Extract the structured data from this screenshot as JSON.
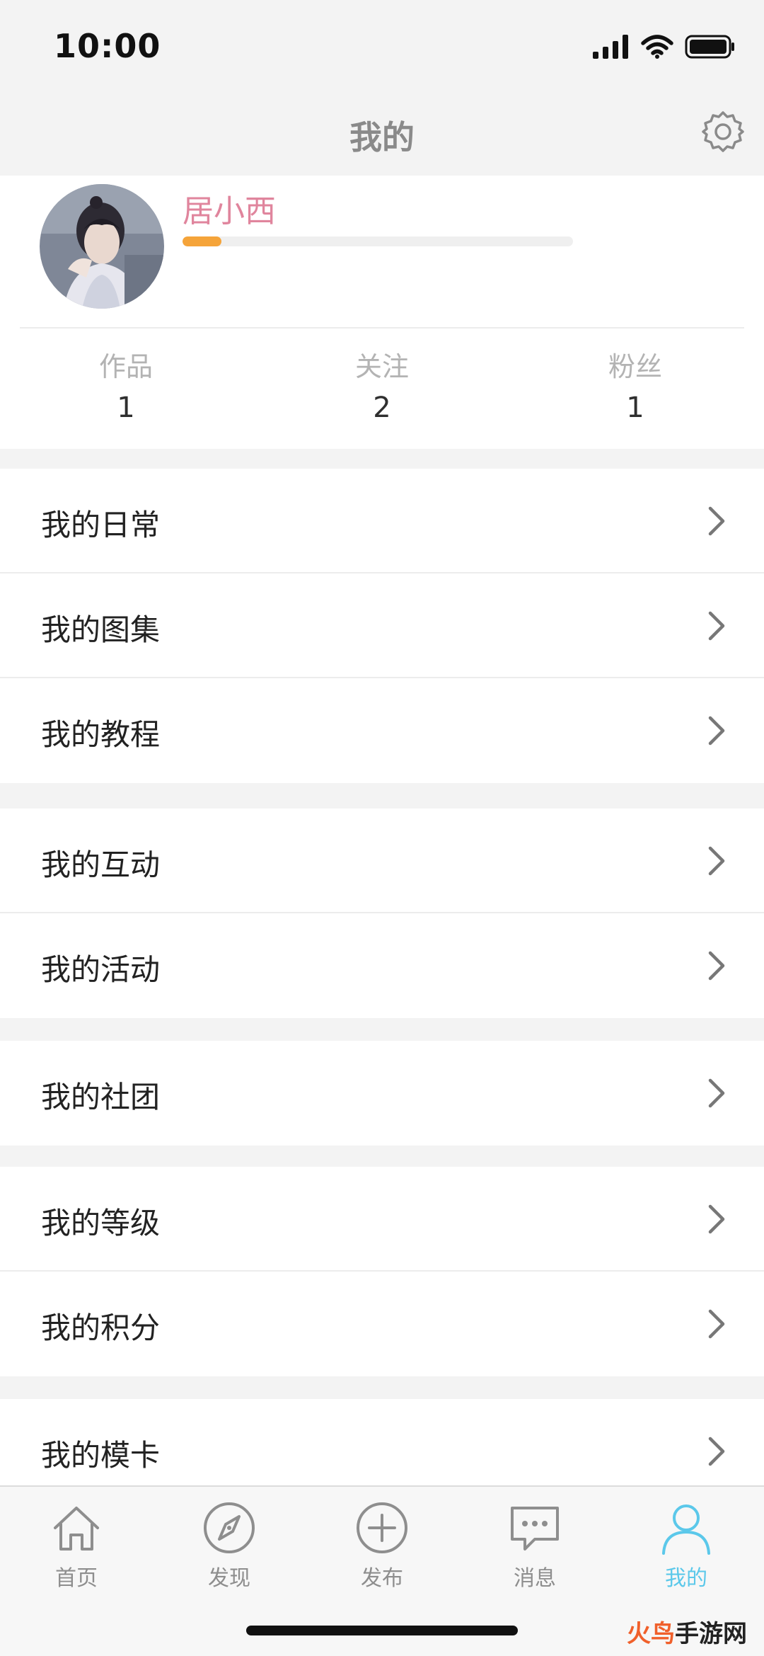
{
  "status_bar": {
    "time": "10:00"
  },
  "nav": {
    "title": "我的",
    "settings_icon": "gear-icon"
  },
  "profile": {
    "username": "居小西",
    "level_progress": 0.1,
    "stats": [
      {
        "label": "作品",
        "value": "1"
      },
      {
        "label": "关注",
        "value": "2"
      },
      {
        "label": "粉丝",
        "value": "1"
      }
    ]
  },
  "menu_groups": [
    {
      "items": [
        {
          "label": "我的日常"
        },
        {
          "label": "我的图集"
        },
        {
          "label": "我的教程"
        }
      ]
    },
    {
      "items": [
        {
          "label": "我的互动"
        },
        {
          "label": "我的活动"
        }
      ]
    },
    {
      "items": [
        {
          "label": "我的社团"
        }
      ]
    },
    {
      "items": [
        {
          "label": "我的等级"
        },
        {
          "label": "我的积分"
        }
      ]
    },
    {
      "items": [
        {
          "label": "我的模卡"
        }
      ]
    }
  ],
  "tab_bar": {
    "tabs": [
      {
        "label": "首页",
        "icon": "home-icon"
      },
      {
        "label": "发现",
        "icon": "compass-icon"
      },
      {
        "label": "发布",
        "icon": "plus-circle-icon"
      },
      {
        "label": "消息",
        "icon": "chat-bubble-icon"
      },
      {
        "label": "我的",
        "icon": "user-icon",
        "active": true
      }
    ]
  },
  "colors": {
    "username": "#e0859d",
    "level_fill": "#f5a43a",
    "active_tab": "#5bc8ea"
  },
  "watermark": {
    "part1": "火鸟",
    "part2": "手游网"
  }
}
